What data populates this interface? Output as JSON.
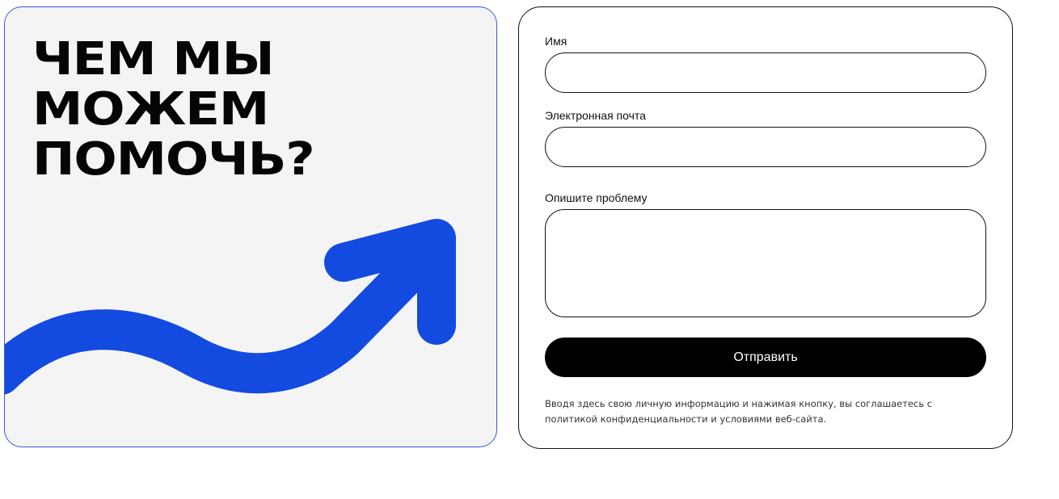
{
  "promo": {
    "headline_line1": "ЧЕМ МЫ",
    "headline_line2": "МОЖЕМ",
    "headline_line3": "ПОМОЧЬ?",
    "arrow_color": "#134ae0",
    "background_color": "#f4f4f5"
  },
  "form": {
    "name_label": "Имя",
    "name_value": "",
    "email_label": "Электронная почта",
    "email_value": "",
    "problem_label": "Опишите проблему",
    "problem_value": "",
    "submit_label": "Отправить",
    "disclaimer": "Вводя здесь свою личную информацию и нажимая кнопку, вы соглашаетесь с политикой конфиденциальности и условиями веб-сайта."
  }
}
